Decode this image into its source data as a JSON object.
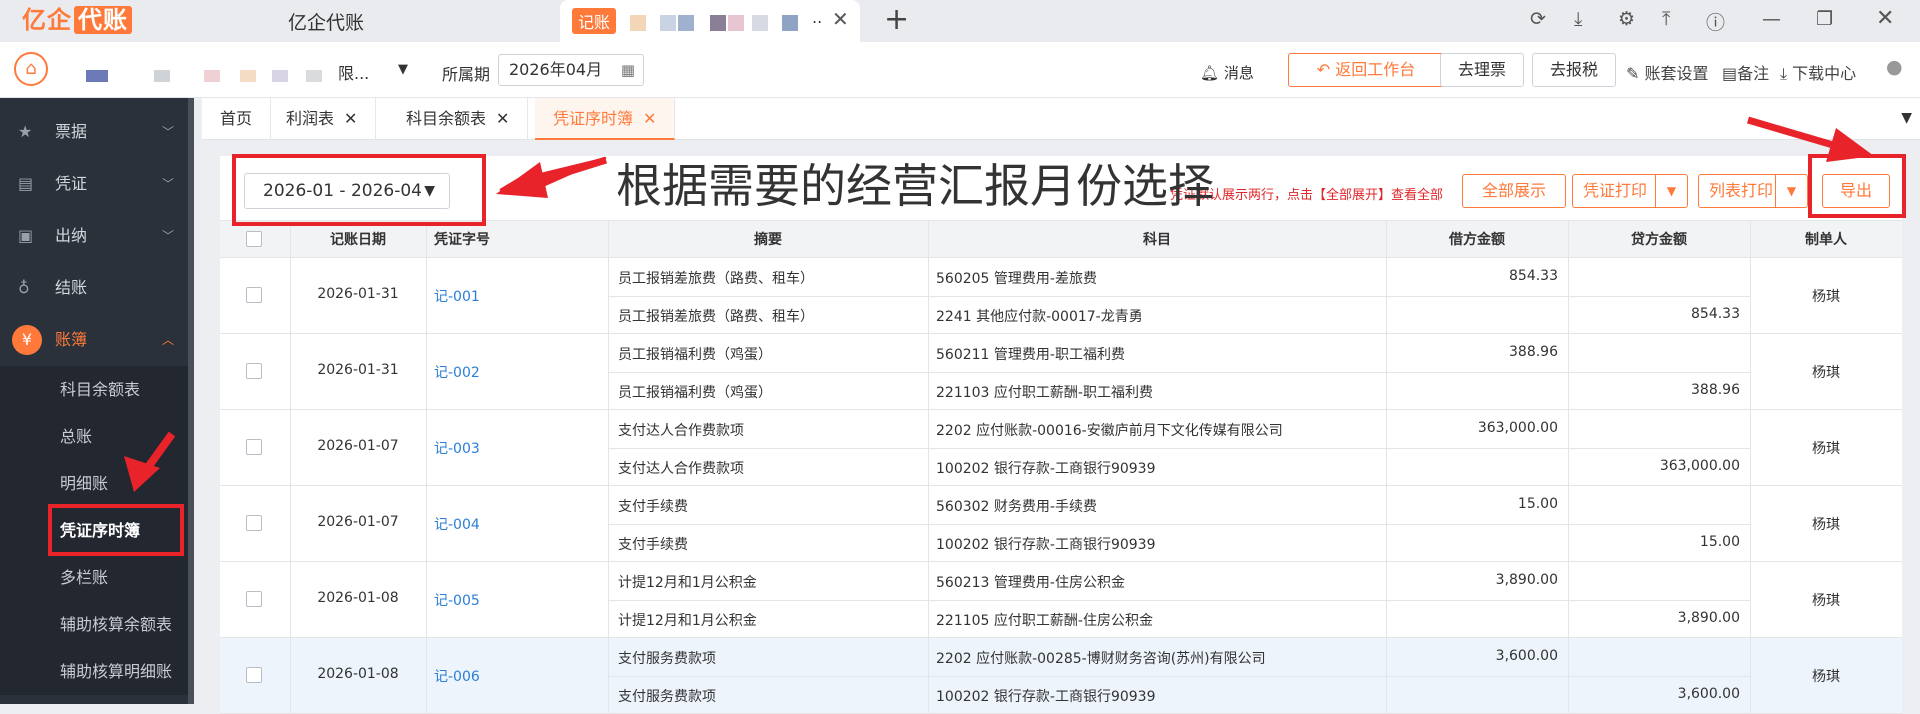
{
  "browser": {
    "brand": "亿企代账",
    "brand_main": "亿企",
    "brand_box": "代账",
    "tab1_title": "亿企代账",
    "tab2_logo": "记账",
    "tab2_ellipsis": "..",
    "tab_close": "✕",
    "new_tab": "+"
  },
  "toolbar": {
    "company_suffix": "限...",
    "period_label": "所属期",
    "period_value": "2026年04月",
    "messages": "消息",
    "back_button": "返回工作台",
    "invoice_button": "去理票",
    "tax_button": "去报税",
    "ledger_settings": "账套设置",
    "notes": "备注",
    "download_center": "下载中心"
  },
  "sidebar": {
    "items": [
      {
        "label": "票据",
        "icon": "ticket-icon"
      },
      {
        "label": "凭证",
        "icon": "document-icon"
      },
      {
        "label": "出纳",
        "icon": "wallet-icon"
      },
      {
        "label": "结账",
        "icon": "moneybag-icon"
      },
      {
        "label": "账簿",
        "icon": "book-icon"
      }
    ],
    "subitems": [
      "科目余额表",
      "总账",
      "明细账",
      "凭证序时簿",
      "多栏账",
      "辅助核算余额表",
      "辅助核算明细账"
    ]
  },
  "page_tabs": [
    {
      "label": "首页"
    },
    {
      "label": "利润表"
    },
    {
      "label": "科目余额表"
    },
    {
      "label": "凭证序时簿"
    }
  ],
  "filter": {
    "range": "2026-01 - 2026-04",
    "hint": "凭证默认展示两行，点击【全部展开】查看全部",
    "expand_all": "全部展示",
    "voucher_print": "凭证打印",
    "list_print": "列表打印",
    "export": "导出"
  },
  "annotation": {
    "text": "根据需要的经营汇报月份选择"
  },
  "table": {
    "headers": {
      "date": "记账日期",
      "voucher_no": "凭证字号",
      "summary": "摘要",
      "account": "科目",
      "debit": "借方金额",
      "credit": "贷方金额",
      "maker": "制单人"
    },
    "groups": [
      {
        "date": "2026-01-31",
        "no": "记-001",
        "maker": "杨琪",
        "lines": [
          {
            "summary": "员工报销差旅费（路费、租车）",
            "account": "560205 管理费用-差旅费",
            "debit": "854.33",
            "credit": ""
          },
          {
            "summary": "员工报销差旅费（路费、租车）",
            "account": "2241 其他应付款-00017-龙青勇",
            "debit": "",
            "credit": "854.33"
          }
        ]
      },
      {
        "date": "2026-01-31",
        "no": "记-002",
        "maker": "杨琪",
        "lines": [
          {
            "summary": "员工报销福利费（鸡蛋）",
            "account": "560211 管理费用-职工福利费",
            "debit": "388.96",
            "credit": ""
          },
          {
            "summary": "员工报销福利费（鸡蛋）",
            "account": "221103 应付职工薪酬-职工福利费",
            "debit": "",
            "credit": "388.96"
          }
        ]
      },
      {
        "date": "2026-01-07",
        "no": "记-003",
        "maker": "杨琪",
        "lines": [
          {
            "summary": "支付达人合作费款项",
            "account": "2202 应付账款-00016-安徽庐前月下文化传媒有限公司",
            "debit": "363,000.00",
            "credit": ""
          },
          {
            "summary": "支付达人合作费款项",
            "account": "100202 银行存款-工商银行90939",
            "debit": "",
            "credit": "363,000.00"
          }
        ]
      },
      {
        "date": "2026-01-07",
        "no": "记-004",
        "maker": "杨琪",
        "lines": [
          {
            "summary": "支付手续费",
            "account": "560302 财务费用-手续费",
            "debit": "15.00",
            "credit": ""
          },
          {
            "summary": "支付手续费",
            "account": "100202 银行存款-工商银行90939",
            "debit": "",
            "credit": "15.00"
          }
        ]
      },
      {
        "date": "2026-01-08",
        "no": "记-005",
        "maker": "杨琪",
        "lines": [
          {
            "summary": "计提12月和1月公积金",
            "account": "560213 管理费用-住房公积金",
            "debit": "3,890.00",
            "credit": ""
          },
          {
            "summary": "计提12月和1月公积金",
            "account": "221105 应付职工薪酬-住房公积金",
            "debit": "",
            "credit": "3,890.00"
          }
        ]
      },
      {
        "date": "2026-01-08",
        "no": "记-006",
        "maker": "杨琪",
        "lines": [
          {
            "summary": "支付服务费款项",
            "account": "2202 应付账款-00285-博财财务咨询(苏州)有限公司",
            "debit": "3,600.00",
            "credit": ""
          },
          {
            "summary": "支付服务费款项",
            "account": "100202 银行存款-工商银行90939",
            "debit": "",
            "credit": "3,600.00"
          }
        ]
      }
    ]
  },
  "colors": {
    "accent": "#ff7a3a",
    "annotation": "#e8232a",
    "link": "#2b7fd6"
  }
}
